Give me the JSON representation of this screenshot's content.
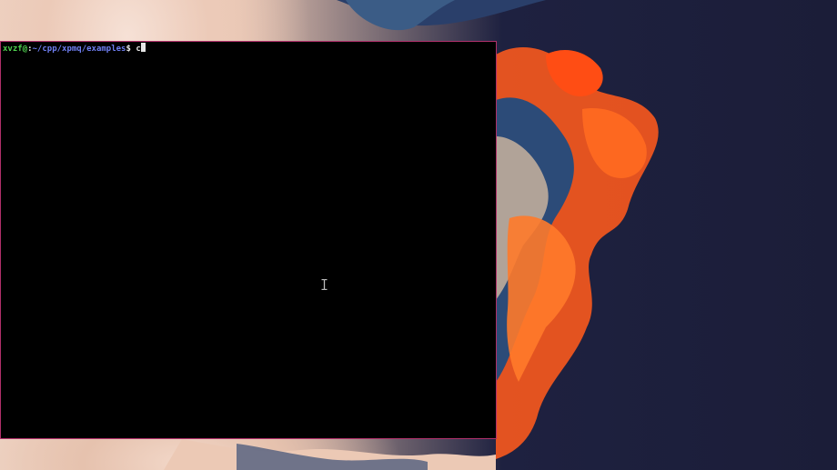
{
  "desktop": {
    "wallpaper": "abstract fluid art, cream/orange/navy",
    "colors": {
      "navy": "#1b1d38",
      "orange": "#ff5a1c",
      "cream": "#f2d7c8",
      "steel": "#3b5c86"
    }
  },
  "terminal": {
    "border_color": "#b0306a",
    "prompt": {
      "user_host": "xvzf@",
      "separator": ":",
      "path": "~/cpp/xpmq/examples",
      "symbol": "$ ",
      "command": "c"
    },
    "cursor_icon": "text-ibeam-icon"
  }
}
